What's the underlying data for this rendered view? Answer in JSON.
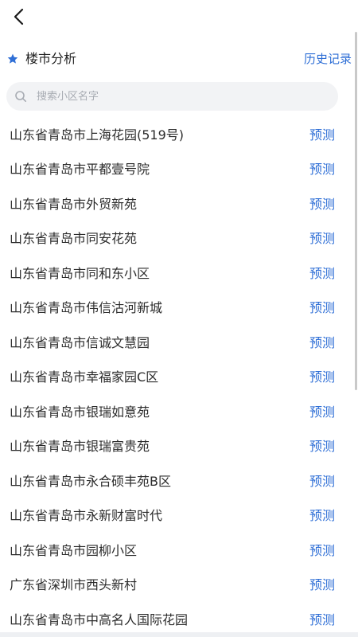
{
  "header": {
    "title": "楼市分析",
    "history_label": "历史记录"
  },
  "search": {
    "placeholder": "搜索小区名字",
    "value": ""
  },
  "list": {
    "action_label": "预测",
    "items": [
      "山东省青岛市上海花园(519号)",
      "山东省青岛市平都壹号院",
      "山东省青岛市外贸新苑",
      "山东省青岛市同安花苑",
      "山东省青岛市同和东小区",
      "山东省青岛市伟信沽河新城",
      "山东省青岛市信诚文慧园",
      "山东省青岛市幸福家园C区",
      "山东省青岛市银瑞如意苑",
      "山东省青岛市银瑞富贵苑",
      "山东省青岛市永合硕丰苑B区",
      "山东省青岛市永新财富时代",
      "山东省青岛市园柳小区",
      "广东省深圳市西头新村",
      "山东省青岛市中高名人国际花园"
    ]
  },
  "colors": {
    "accent": "#2f6fd6",
    "search_bg": "#f2f3f5"
  },
  "icons": {
    "back": "chevron-left-icon",
    "star": "star-icon",
    "search": "search-icon"
  }
}
